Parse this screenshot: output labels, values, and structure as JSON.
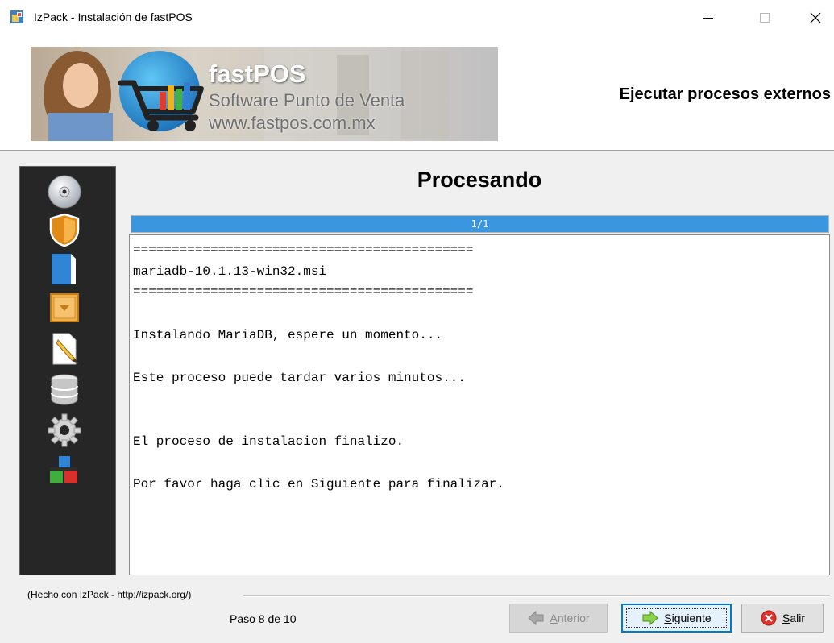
{
  "window": {
    "title": "IzPack - Instalación de fastPOS",
    "minimize_symbol": "—",
    "maximize_symbol": "☐",
    "close_symbol": "✕"
  },
  "header": {
    "banner_brand": "fastPOS",
    "banner_tagline": "Software Punto de Venta",
    "banner_url": "www.fastpos.com.mx",
    "title": "Ejecutar procesos externos"
  },
  "sidebar": {
    "icons": [
      "cd-icon",
      "shield-icon",
      "document-icon",
      "package-icon",
      "edit-document-icon",
      "database-icon",
      "gear-icon",
      "blocks-icon"
    ]
  },
  "panel": {
    "title": "Procesando",
    "progress_text": "1/1",
    "progress_fraction": 1.0,
    "progress_color": "#3a97df",
    "log_lines": [
      "============================================",
      "mariadb-10.1.13-win32.msi",
      "============================================",
      "",
      "Instalando MariaDB, espere un momento...",
      "",
      "Este proceso puede tardar varios minutos...",
      "",
      "",
      "El proceso de instalacion finalizo.",
      "",
      "Por favor haga clic en Siguiente para finalizar."
    ]
  },
  "footer": {
    "credit": "(Hecho con IzPack - http://izpack.org/)",
    "step": "Paso 8 de 10",
    "prev_label_first": "A",
    "prev_label_rest": "nterior",
    "next_label_first": "S",
    "next_label_rest": "iguiente",
    "exit_label_first": "S",
    "exit_label_rest": "alir"
  }
}
